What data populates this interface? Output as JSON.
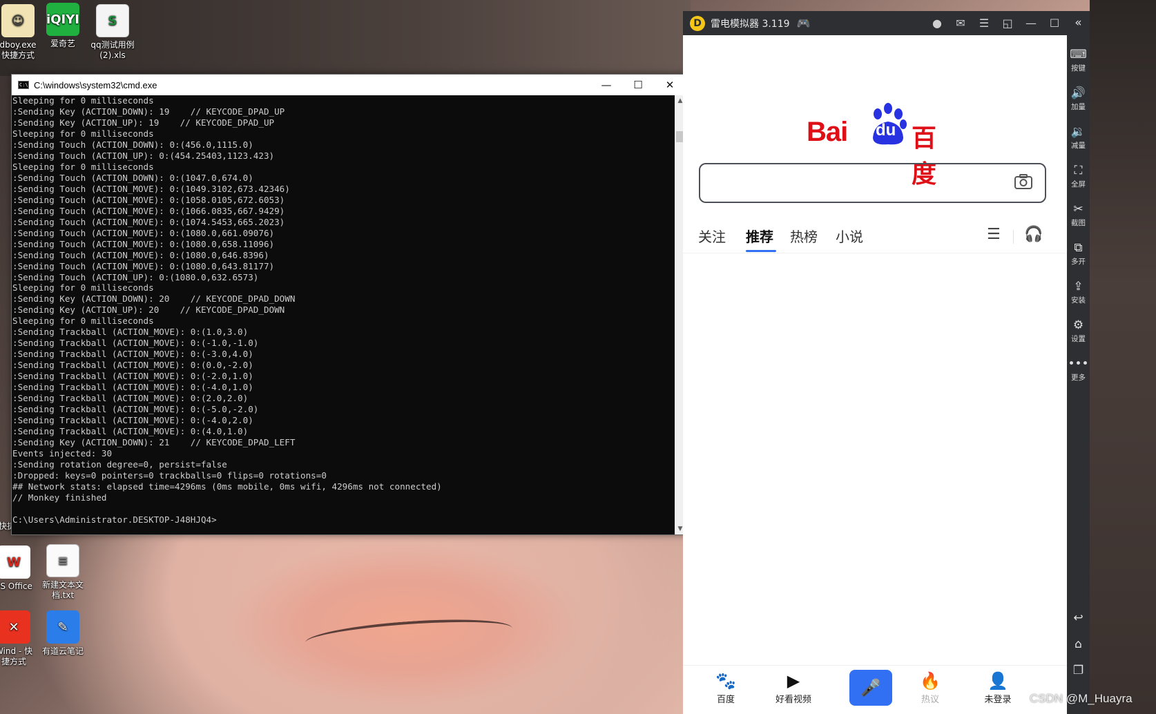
{
  "desktop": {
    "icons": [
      {
        "label": "dboy.exe\n快捷方式",
        "glyph": "☺"
      },
      {
        "label": "爱奇艺",
        "glyph": "iQIYI"
      },
      {
        "label": "qq测试用例\n(2).xls",
        "glyph": "S"
      },
      {
        "label": "PS Office",
        "glyph": "W"
      },
      {
        "label": "新建文本文\n档.txt",
        "glyph": "≡"
      },
      {
        "label": "Wind - 快\n捷方式",
        "glyph": "✕"
      },
      {
        "label": "有道云笔记",
        "glyph": "✎"
      },
      {
        "label": "快捷方式",
        "glyph": ""
      }
    ]
  },
  "cmd": {
    "title": "C:\\windows\\system32\\cmd.exe",
    "icon_text": "C:\\",
    "lines": [
      "Sleeping for 0 milliseconds",
      ":Sending Key (ACTION_DOWN): 19    // KEYCODE_DPAD_UP",
      ":Sending Key (ACTION_UP): 19    // KEYCODE_DPAD_UP",
      "Sleeping for 0 milliseconds",
      ":Sending Touch (ACTION_DOWN): 0:(456.0,1115.0)",
      ":Sending Touch (ACTION_UP): 0:(454.25403,1123.423)",
      "Sleeping for 0 milliseconds",
      ":Sending Touch (ACTION_DOWN): 0:(1047.0,674.0)",
      ":Sending Touch (ACTION_MOVE): 0:(1049.3102,673.42346)",
      ":Sending Touch (ACTION_MOVE): 0:(1058.0105,672.6053)",
      ":Sending Touch (ACTION_MOVE): 0:(1066.0835,667.9429)",
      ":Sending Touch (ACTION_MOVE): 0:(1074.5453,665.2023)",
      ":Sending Touch (ACTION_MOVE): 0:(1080.0,661.09076)",
      ":Sending Touch (ACTION_MOVE): 0:(1080.0,658.11096)",
      ":Sending Touch (ACTION_MOVE): 0:(1080.0,646.8396)",
      ":Sending Touch (ACTION_MOVE): 0:(1080.0,643.81177)",
      ":Sending Touch (ACTION_UP): 0:(1080.0,632.6573)",
      "Sleeping for 0 milliseconds",
      ":Sending Key (ACTION_DOWN): 20    // KEYCODE_DPAD_DOWN",
      ":Sending Key (ACTION_UP): 20    // KEYCODE_DPAD_DOWN",
      "Sleeping for 0 milliseconds",
      ":Sending Trackball (ACTION_MOVE): 0:(1.0,3.0)",
      ":Sending Trackball (ACTION_MOVE): 0:(-1.0,-1.0)",
      ":Sending Trackball (ACTION_MOVE): 0:(-3.0,4.0)",
      ":Sending Trackball (ACTION_MOVE): 0:(0.0,-2.0)",
      ":Sending Trackball (ACTION_MOVE): 0:(-2.0,1.0)",
      ":Sending Trackball (ACTION_MOVE): 0:(-4.0,1.0)",
      ":Sending Trackball (ACTION_MOVE): 0:(2.0,2.0)",
      ":Sending Trackball (ACTION_MOVE): 0:(-5.0,-2.0)",
      ":Sending Trackball (ACTION_MOVE): 0:(-4.0,2.0)",
      ":Sending Trackball (ACTION_MOVE): 0:(4.0,1.0)",
      ":Sending Key (ACTION_DOWN): 21    // KEYCODE_DPAD_LEFT",
      "Events injected: 30",
      ":Sending rotation degree=0, persist=false",
      ":Dropped: keys=0 pointers=0 trackballs=0 flips=0 rotations=0",
      "## Network stats: elapsed time=4296ms (0ms mobile, 0ms wifi, 4296ms not connected)",
      "// Monkey finished",
      "",
      "C:\\Users\\Administrator.DESKTOP-J48HJQ4>"
    ]
  },
  "emulator": {
    "title": "雷电模拟器 3.119",
    "logo_text": "D",
    "sidebar": [
      {
        "label": "按键",
        "icon": "⌨",
        "icon_name": "keyboard-icon"
      },
      {
        "label": "加量",
        "icon": "🔊",
        "icon_name": "volume-up-icon"
      },
      {
        "label": "减量",
        "icon": "🔉",
        "icon_name": "volume-down-icon"
      },
      {
        "label": "全屏",
        "icon": "⛶",
        "icon_name": "fullscreen-icon"
      },
      {
        "label": "截图",
        "icon": "✂",
        "icon_name": "scissors-icon"
      },
      {
        "label": "多开",
        "icon": "⧉",
        "icon_name": "multi-instance-icon"
      },
      {
        "label": "安装",
        "icon": "⇪",
        "icon_name": "apk-install-icon"
      },
      {
        "label": "设置",
        "icon": "⚙",
        "icon_name": "gear-icon"
      },
      {
        "label": "更多",
        "icon": "•••",
        "icon_name": "more-icon"
      }
    ]
  },
  "baidu": {
    "logo_bai": "Bai",
    "logo_du": "du",
    "logo_cn": "百度",
    "tabs": [
      {
        "label": "关注",
        "active": false
      },
      {
        "label": "推荐",
        "active": true
      },
      {
        "label": "热榜",
        "active": false
      },
      {
        "label": "小说",
        "active": false
      }
    ],
    "accent": "#3270f3",
    "brand_red": "#de0f17",
    "bottom_nav": [
      {
        "label": "百度",
        "icon": "🐾",
        "muted": false
      },
      {
        "label": "好看视频",
        "icon": "▶",
        "muted": false
      },
      {
        "label": "热议",
        "icon": "🔥",
        "muted": true
      },
      {
        "label": "未登录",
        "icon": "👤",
        "muted": false
      }
    ]
  },
  "watermark": "CSDN @M_Huayra"
}
